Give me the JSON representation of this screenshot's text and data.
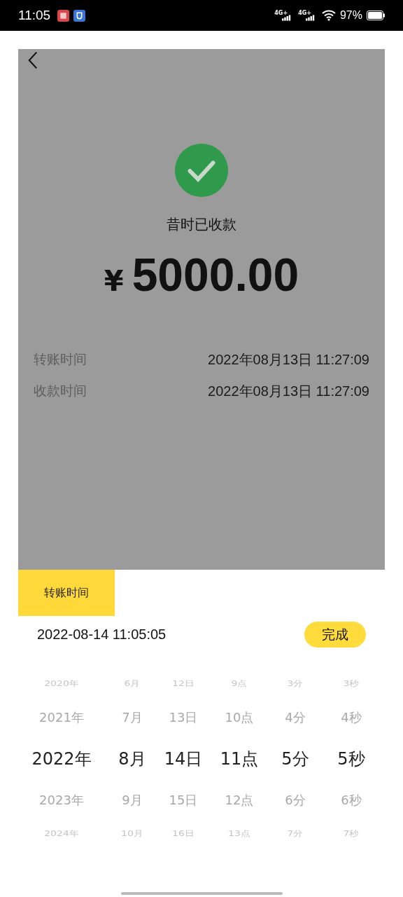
{
  "status_bar": {
    "time": "11:05",
    "networks": [
      "4G+",
      "4G+"
    ],
    "battery": "97%"
  },
  "receipt": {
    "status": "昔时已收款",
    "currency": "¥",
    "amount": "5000.00",
    "details": [
      {
        "label": "转账时间",
        "value": "2022年08月13日 11:27:09"
      },
      {
        "label": "收款时间",
        "value": "2022年08月13日 11:27:09"
      }
    ]
  },
  "picker_tab": {
    "label": "转账时间",
    "selected": true
  },
  "picker": {
    "value": "2022-08-14 11:05:05",
    "done_button": "完成",
    "columns": [
      {
        "items": [
          {
            "label": "2020年",
            "selected": false
          },
          {
            "label": "2021年",
            "selected": false
          },
          {
            "label": "2022年",
            "selected": true
          },
          {
            "label": "2023年",
            "selected": false
          },
          {
            "label": "2024年",
            "selected": false
          }
        ]
      },
      {
        "items": [
          {
            "label": "6月",
            "selected": false
          },
          {
            "label": "7月",
            "selected": false
          },
          {
            "label": "8月",
            "selected": true
          },
          {
            "label": "9月",
            "selected": false
          },
          {
            "label": "10月",
            "selected": false
          }
        ]
      },
      {
        "items": [
          {
            "label": "12日",
            "selected": false
          },
          {
            "label": "13日",
            "selected": false
          },
          {
            "label": "14日",
            "selected": true
          },
          {
            "label": "15日",
            "selected": false
          },
          {
            "label": "16日",
            "selected": false
          }
        ]
      },
      {
        "items": [
          {
            "label": "9点",
            "selected": false
          },
          {
            "label": "10点",
            "selected": false
          },
          {
            "label": "11点",
            "selected": true
          },
          {
            "label": "12点",
            "selected": false
          },
          {
            "label": "13点",
            "selected": false
          }
        ]
      },
      {
        "items": [
          {
            "label": "3分",
            "selected": false
          },
          {
            "label": "4分",
            "selected": false
          },
          {
            "label": "5分",
            "selected": true
          },
          {
            "label": "6分",
            "selected": false
          },
          {
            "label": "7分",
            "selected": false
          }
        ]
      },
      {
        "items": [
          {
            "label": "3秒",
            "selected": false
          },
          {
            "label": "4秒",
            "selected": false
          },
          {
            "label": "5秒",
            "selected": true
          },
          {
            "label": "6秒",
            "selected": false
          },
          {
            "label": "7秒",
            "selected": false
          }
        ]
      }
    ]
  }
}
